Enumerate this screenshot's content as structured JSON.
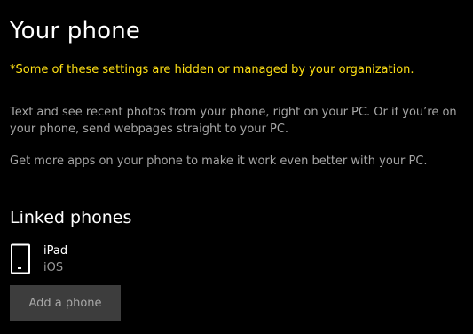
{
  "page": {
    "title": "Your phone",
    "managed_warning": "*Some of these settings are hidden or managed by your organization.",
    "description_1": "Text and see recent photos from your phone, right on your PC. Or if you’re on your phone, send webpages straight to your PC.",
    "description_2": "Get more apps on your phone to make it work even better with your PC."
  },
  "linked_phones": {
    "heading": "Linked phones",
    "devices": [
      {
        "name": "iPad",
        "os": "iOS",
        "icon": "phone-icon"
      }
    ],
    "add_button_label": "Add a phone"
  },
  "colors": {
    "background": "#000000",
    "warning": "#ffe014",
    "secondary_text": "#a6a6a6",
    "button_background": "#3d3d3d"
  }
}
